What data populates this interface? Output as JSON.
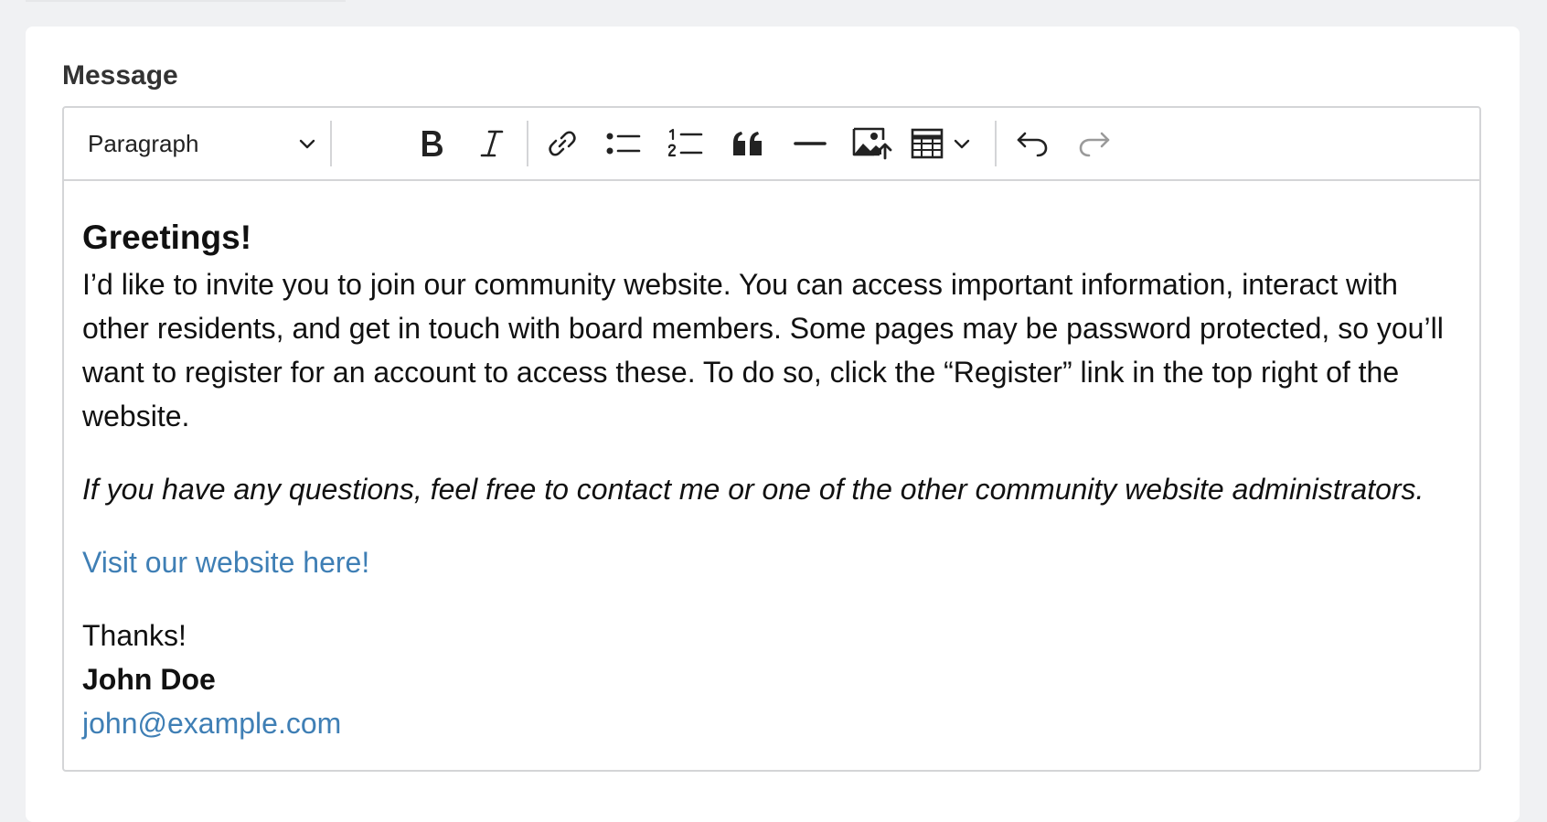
{
  "form": {
    "label": "Message"
  },
  "toolbar": {
    "paragraph_style": "Paragraph",
    "buttons": [
      "bold",
      "italic",
      "link",
      "bulleted-list",
      "numbered-list",
      "block-quote",
      "horizontal-line",
      "insert-image",
      "insert-table",
      "undo",
      "redo"
    ]
  },
  "content": {
    "greeting": "Greetings!",
    "body": "I’d like to invite you to join our community website. You can access important information, interact with other residents, and get in touch with board members. Some pages may be password protected, so you’ll want to register for an account to access these. To do so, click the “Register” link in the top right of the website.",
    "italic_note": "If you have any questions, feel free to contact me or one of the other community website administrators.",
    "website_link": "Visit our website here!",
    "thanks": "Thanks!",
    "signature_name": "John Doe",
    "signature_email": "john@example.com"
  },
  "colors": {
    "link": "#3f7fb5",
    "page_background": "#f0f1f3",
    "border": "#d4d5d7"
  }
}
